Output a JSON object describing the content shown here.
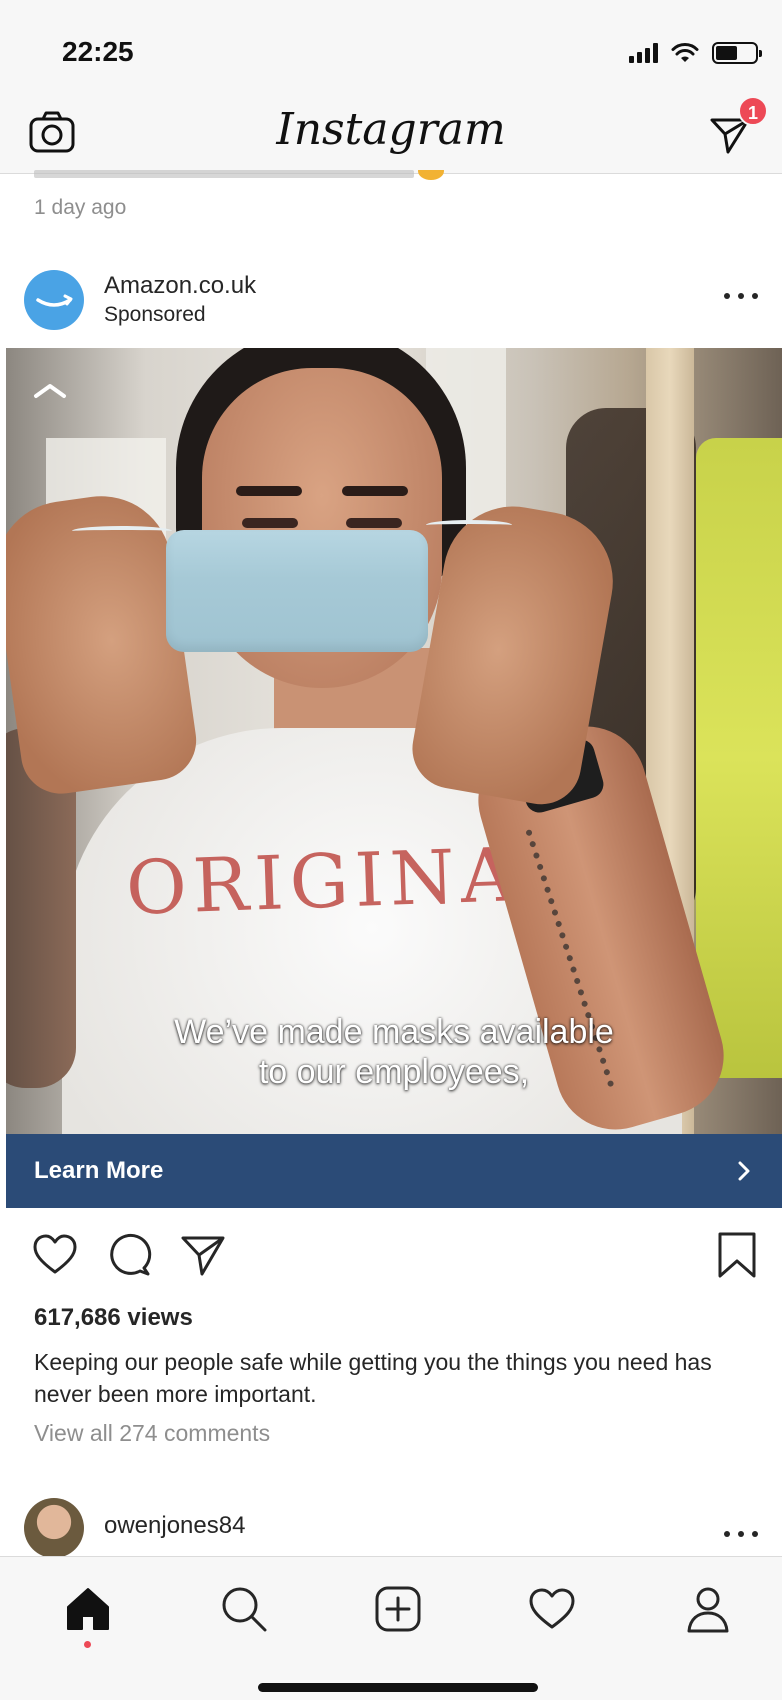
{
  "status_bar": {
    "time": "22:25"
  },
  "header": {
    "logo": "Instagram",
    "notification_count": "1"
  },
  "previous_post": {
    "timestamp": "1 day ago"
  },
  "post": {
    "username": "Amazon.co.uk",
    "label": "Sponsored",
    "media": {
      "shirt_text": "ORIGINAL",
      "caption_line1": "We’ve made masks available",
      "caption_line2": "to our employees,"
    },
    "cta_label": "Learn More",
    "views": "617,686 views",
    "caption": "Keeping our people safe while getting you the things you need has never been more important.",
    "view_comments": "View all 274 comments"
  },
  "next_post": {
    "username": "owenjones84"
  },
  "colors": {
    "cta_background": "#2b4b77",
    "badge": "#ed4956",
    "amazon_avatar": "#4aa3e5"
  },
  "icons": {
    "header_left": "camera-icon",
    "header_right": "direct-message-icon",
    "actions": [
      "heart-icon",
      "comment-icon",
      "share-icon",
      "bookmark-icon"
    ],
    "nav": [
      "home-icon",
      "search-icon",
      "new-post-icon",
      "activity-heart-icon",
      "profile-icon"
    ]
  }
}
